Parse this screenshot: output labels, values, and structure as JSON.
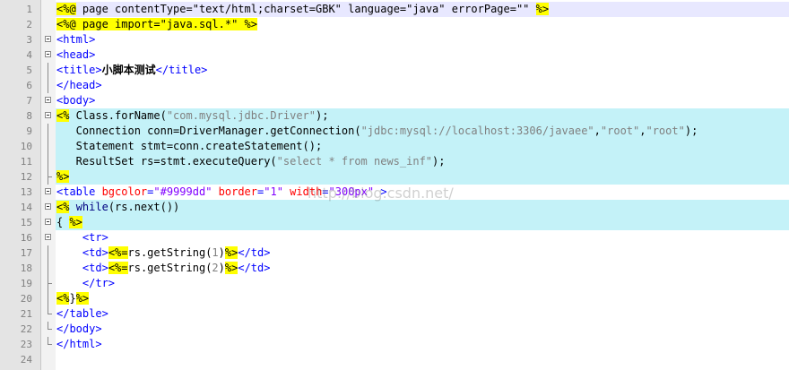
{
  "editor": {
    "lines": [
      {
        "n": "1",
        "segs": [
          [
            "scr",
            "<%@"
          ],
          [
            "plain",
            " page contentType=\"text/html;charset=GBK\" language=\"java\" errorPage=\"\" "
          ],
          [
            "scr",
            "%>"
          ]
        ]
      },
      {
        "n": "2",
        "segs": [
          [
            "scr",
            "<%@ page import=\"java.sql.*\" %>"
          ]
        ]
      },
      {
        "n": "3",
        "segs": [
          [
            "tag",
            "<html>"
          ]
        ]
      },
      {
        "n": "4",
        "segs": [
          [
            "tag",
            "<head>"
          ]
        ]
      },
      {
        "n": "5",
        "segs": [
          [
            "tag",
            "<title>"
          ],
          [
            "bold",
            "小脚本测试"
          ],
          [
            "tag",
            "</title>"
          ]
        ]
      },
      {
        "n": "6",
        "segs": [
          [
            "tag",
            "</head>"
          ]
        ]
      },
      {
        "n": "7",
        "segs": [
          [
            "tag",
            "<body>"
          ]
        ]
      },
      {
        "n": "8",
        "segs": [
          [
            "scr",
            "<%"
          ],
          [
            "plain",
            " Class.forName("
          ],
          [
            "jstr",
            "\"com.mysql.jdbc.Driver\""
          ],
          [
            "plain",
            ");"
          ]
        ]
      },
      {
        "n": "9",
        "segs": [
          [
            "plain",
            "   Connection conn=DriverManager.getConnection("
          ],
          [
            "jstr",
            "\"jdbc:mysql://localhost:3306/javaee\""
          ],
          [
            "plain",
            ","
          ],
          [
            "jstr",
            "\"root\""
          ],
          [
            "plain",
            ","
          ],
          [
            "jstr",
            "\"root\""
          ],
          [
            "plain",
            ");"
          ]
        ]
      },
      {
        "n": "10",
        "segs": [
          [
            "plain",
            "   Statement stmt=conn.createStatement();"
          ]
        ]
      },
      {
        "n": "11",
        "segs": [
          [
            "plain",
            "   ResultSet rs=stmt.executeQuery("
          ],
          [
            "jstr",
            "\"select * from news_inf\""
          ],
          [
            "plain",
            ");"
          ]
        ]
      },
      {
        "n": "12",
        "segs": [
          [
            "scr",
            "%>"
          ]
        ]
      },
      {
        "n": "13",
        "segs": [
          [
            "tag",
            "<table "
          ],
          [
            "attr",
            "bgcolor"
          ],
          [
            "tag",
            "="
          ],
          [
            "str",
            "\"#9999dd\""
          ],
          [
            "tag",
            " "
          ],
          [
            "attr",
            "border"
          ],
          [
            "tag",
            "="
          ],
          [
            "str",
            "\"1\""
          ],
          [
            "tag",
            " "
          ],
          [
            "attr",
            "width"
          ],
          [
            "tag",
            "="
          ],
          [
            "str",
            "\"300px\""
          ],
          [
            "tag",
            " >"
          ]
        ]
      },
      {
        "n": "14",
        "segs": [
          [
            "scr",
            "<%"
          ],
          [
            "plain",
            " "
          ],
          [
            "kw",
            "while"
          ],
          [
            "plain",
            "(rs.next())"
          ]
        ]
      },
      {
        "n": "15",
        "segs": [
          [
            "plain",
            "{ "
          ],
          [
            "scr",
            "%>"
          ]
        ]
      },
      {
        "n": "16",
        "segs": [
          [
            "plain",
            "    "
          ],
          [
            "tag",
            "<tr>"
          ]
        ]
      },
      {
        "n": "17",
        "segs": [
          [
            "plain",
            "    "
          ],
          [
            "tag",
            "<td>"
          ],
          [
            "scr",
            "<%="
          ],
          [
            "plain",
            "rs.getString("
          ],
          [
            "jstr",
            "1"
          ],
          [
            "plain",
            ")"
          ],
          [
            "scr",
            "%>"
          ],
          [
            "tag",
            "</td>"
          ]
        ]
      },
      {
        "n": "18",
        "segs": [
          [
            "plain",
            "    "
          ],
          [
            "tag",
            "<td>"
          ],
          [
            "scr",
            "<%="
          ],
          [
            "plain",
            "rs.getString("
          ],
          [
            "jstr",
            "2"
          ],
          [
            "plain",
            ")"
          ],
          [
            "scr",
            "%>"
          ],
          [
            "tag",
            "</td>"
          ]
        ]
      },
      {
        "n": "19",
        "segs": [
          [
            "plain",
            "    "
          ],
          [
            "tag",
            "</tr>"
          ]
        ]
      },
      {
        "n": "20",
        "segs": [
          [
            "scr",
            "<%"
          ],
          [
            "plain",
            "}"
          ],
          [
            "scr",
            "%>"
          ]
        ]
      },
      {
        "n": "21",
        "segs": [
          [
            "tag",
            "</table>"
          ]
        ]
      },
      {
        "n": "22",
        "segs": [
          [
            "tag",
            "</body>"
          ]
        ]
      },
      {
        "n": "23",
        "segs": [
          [
            "tag",
            "</html>"
          ]
        ]
      },
      {
        "n": "24",
        "segs": []
      }
    ],
    "watermark": "http://blog.csdn.net/"
  },
  "icons": {
    "fold_open": "fold-minus-icon"
  },
  "colors": {
    "tag": "#0000ff",
    "attr": "#ff0000",
    "string": "#8000ff",
    "script_bg": "#ffff00",
    "cyan_bg": "#c4f2f8",
    "gutter_bg": "#e4e4e4"
  }
}
